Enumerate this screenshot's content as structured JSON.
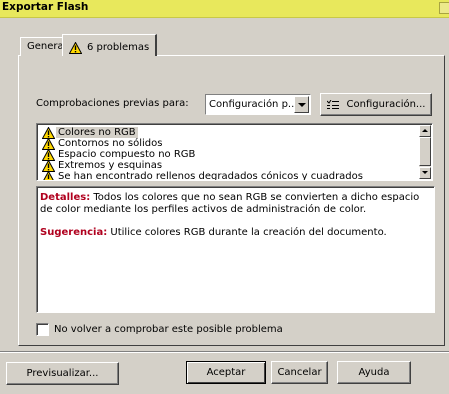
{
  "window": {
    "title": "Exportar Flash"
  },
  "tabs": [
    {
      "label": "General"
    },
    {
      "label": "6 problemas",
      "icon": "warning-icon"
    }
  ],
  "precheck": {
    "label": "Comprobaciones previas para:",
    "dropdown_value": "Configuración p...",
    "config_button": "Configuración..."
  },
  "problems": [
    "Colores no RGB",
    "Contornos no sólidos",
    "Espacio compuesto no RGB",
    "Extremos y esquinas",
    "Se han encontrado rellenos degradados cónicos y cuadrados"
  ],
  "details": {
    "detalles_label": "Detalles:",
    "detalles_text": "Todos los colores que no sean RGB se convierten a dicho espacio de color mediante los perfiles activos de administración de color.",
    "sugerencia_label": "Sugerencia:",
    "sugerencia_text": "Utilice colores RGB durante la creación del documento."
  },
  "checkbox": {
    "label": "No volver a comprobar este posible problema",
    "checked": false
  },
  "buttons": {
    "preview": "Previsualizar...",
    "accept": "Aceptar",
    "cancel": "Cancelar",
    "help": "Ayuda"
  },
  "colors": {
    "titlebar": "#e8e85c",
    "warning": "#ffd800",
    "emphasis": "#b0001e"
  }
}
